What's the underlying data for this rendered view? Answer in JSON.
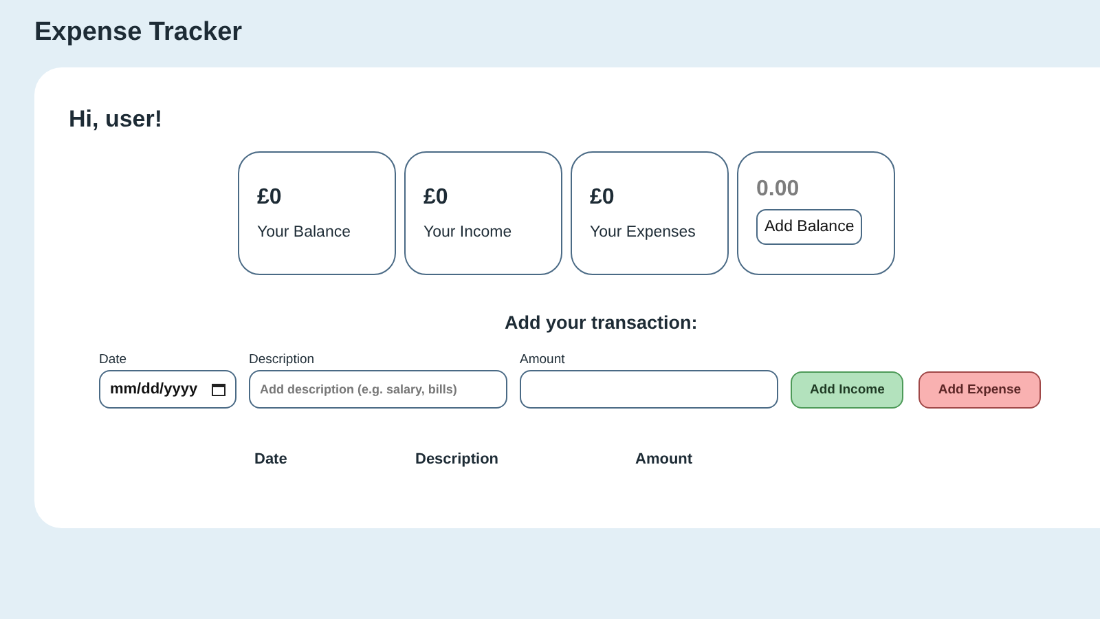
{
  "app_title": "Expense Tracker",
  "greeting": "Hi, user!",
  "stats": [
    {
      "kind": "stat",
      "value": "£0",
      "label": "Your Balance"
    },
    {
      "kind": "stat",
      "value": "£0",
      "label": "Your Income"
    },
    {
      "kind": "stat",
      "value": "£0",
      "label": "Your Expenses"
    },
    {
      "kind": "add",
      "value": "0.00",
      "label": "Add Balance"
    }
  ],
  "form": {
    "title": "Add your transaction:",
    "fields": [
      {
        "kind": "date",
        "label": "Date",
        "value": "mm/dd/yyyy"
      },
      {
        "kind": "text",
        "label": "Description",
        "placeholder": "Add description (e.g. salary, bills)"
      },
      {
        "kind": "text",
        "label": "Amount"
      }
    ],
    "buttons": [
      {
        "kind": "income",
        "label": "Add Income"
      },
      {
        "kind": "expense",
        "label": "Add Expense"
      }
    ]
  },
  "table": {
    "columns": [
      "Date",
      "Description",
      "Amount"
    ]
  }
}
